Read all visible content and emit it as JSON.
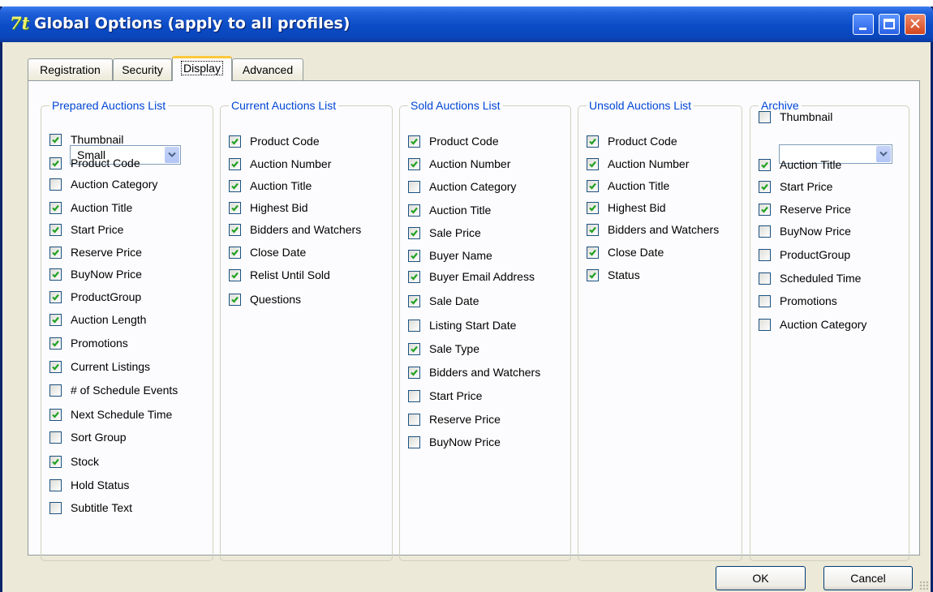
{
  "window": {
    "title": "Global Options (apply to all profiles)",
    "app_icon_glyph": "7t"
  },
  "tabs": [
    {
      "label": "Registration",
      "active": false
    },
    {
      "label": "Security",
      "active": false
    },
    {
      "label": "Display",
      "active": true
    },
    {
      "label": "Advanced",
      "active": false
    }
  ],
  "groups": {
    "prepared": {
      "title": "Prepared Auctions List",
      "thumbnail": {
        "label": "Thumbnail",
        "checked": true,
        "size_value": "Small"
      },
      "items": [
        {
          "label": "Product Code",
          "checked": true
        },
        {
          "label": "Auction Category",
          "checked": false
        },
        {
          "label": "Auction Title",
          "checked": true
        },
        {
          "label": "Start Price",
          "checked": true
        },
        {
          "label": "Reserve Price",
          "checked": true
        },
        {
          "label": "BuyNow Price",
          "checked": true
        },
        {
          "label": "ProductGroup",
          "checked": true
        },
        {
          "label": "Auction Length",
          "checked": true
        },
        {
          "label": "Promotions",
          "checked": true
        },
        {
          "label": "Current Listings",
          "checked": true
        },
        {
          "label": "# of Schedule Events",
          "checked": false
        },
        {
          "label": "Next Schedule Time",
          "checked": true
        },
        {
          "label": "Sort Group",
          "checked": false
        },
        {
          "label": "Stock",
          "checked": true
        },
        {
          "label": "Hold Status",
          "checked": false
        },
        {
          "label": "Subtitle Text",
          "checked": false
        }
      ]
    },
    "current": {
      "title": "Current Auctions List",
      "items": [
        {
          "label": "Product Code",
          "checked": true
        },
        {
          "label": "Auction Number",
          "checked": true
        },
        {
          "label": "Auction Title",
          "checked": true
        },
        {
          "label": "Highest Bid",
          "checked": true
        },
        {
          "label": "Bidders and Watchers",
          "checked": true
        },
        {
          "label": "Close Date",
          "checked": true
        },
        {
          "label": "Relist Until Sold",
          "checked": true
        },
        {
          "label": "Questions",
          "checked": true
        }
      ]
    },
    "sold": {
      "title": "Sold Auctions List",
      "items": [
        {
          "label": "Product Code",
          "checked": true
        },
        {
          "label": "Auction Number",
          "checked": true
        },
        {
          "label": "Auction Category",
          "checked": false
        },
        {
          "label": "Auction Title",
          "checked": true
        },
        {
          "label": "Sale Price",
          "checked": true
        },
        {
          "label": "Buyer Name",
          "checked": true
        },
        {
          "label": "Buyer Email Address",
          "checked": true
        },
        {
          "label": "Sale Date",
          "checked": true
        },
        {
          "label": "Listing Start Date",
          "checked": false
        },
        {
          "label": "Sale Type",
          "checked": true
        },
        {
          "label": "Bidders and Watchers",
          "checked": true
        },
        {
          "label": "Start Price",
          "checked": false
        },
        {
          "label": "Reserve Price",
          "checked": false
        },
        {
          "label": "BuyNow Price",
          "checked": false
        }
      ]
    },
    "unsold": {
      "title": "Unsold Auctions List",
      "items": [
        {
          "label": "Product Code",
          "checked": true
        },
        {
          "label": "Auction Number",
          "checked": true
        },
        {
          "label": "Auction Title",
          "checked": true
        },
        {
          "label": "Highest Bid",
          "checked": true
        },
        {
          "label": "Bidders and Watchers",
          "checked": true
        },
        {
          "label": "Close Date",
          "checked": true
        },
        {
          "label": "Status",
          "checked": true
        }
      ]
    },
    "archive": {
      "title": "Archive",
      "thumbnail": {
        "label": "Thumbnail",
        "checked": false,
        "size_value": ""
      },
      "items": [
        {
          "label": "Auction Title",
          "checked": true
        },
        {
          "label": "Start Price",
          "checked": true
        },
        {
          "label": "Reserve Price",
          "checked": true
        },
        {
          "label": "BuyNow Price",
          "checked": false
        },
        {
          "label": "ProductGroup",
          "checked": false
        },
        {
          "label": "Scheduled Time",
          "checked": false
        },
        {
          "label": "Promotions",
          "checked": false
        },
        {
          "label": "Auction Category",
          "checked": false
        }
      ]
    }
  },
  "buttons": {
    "ok": "OK",
    "cancel": "Cancel"
  },
  "colors": {
    "titlebar": "#0b4cc6",
    "group_title": "#0046d5",
    "check_mark": "#21a121",
    "active_tab_accent": "#ffc83c",
    "dialog_face": "#ece9d8"
  }
}
